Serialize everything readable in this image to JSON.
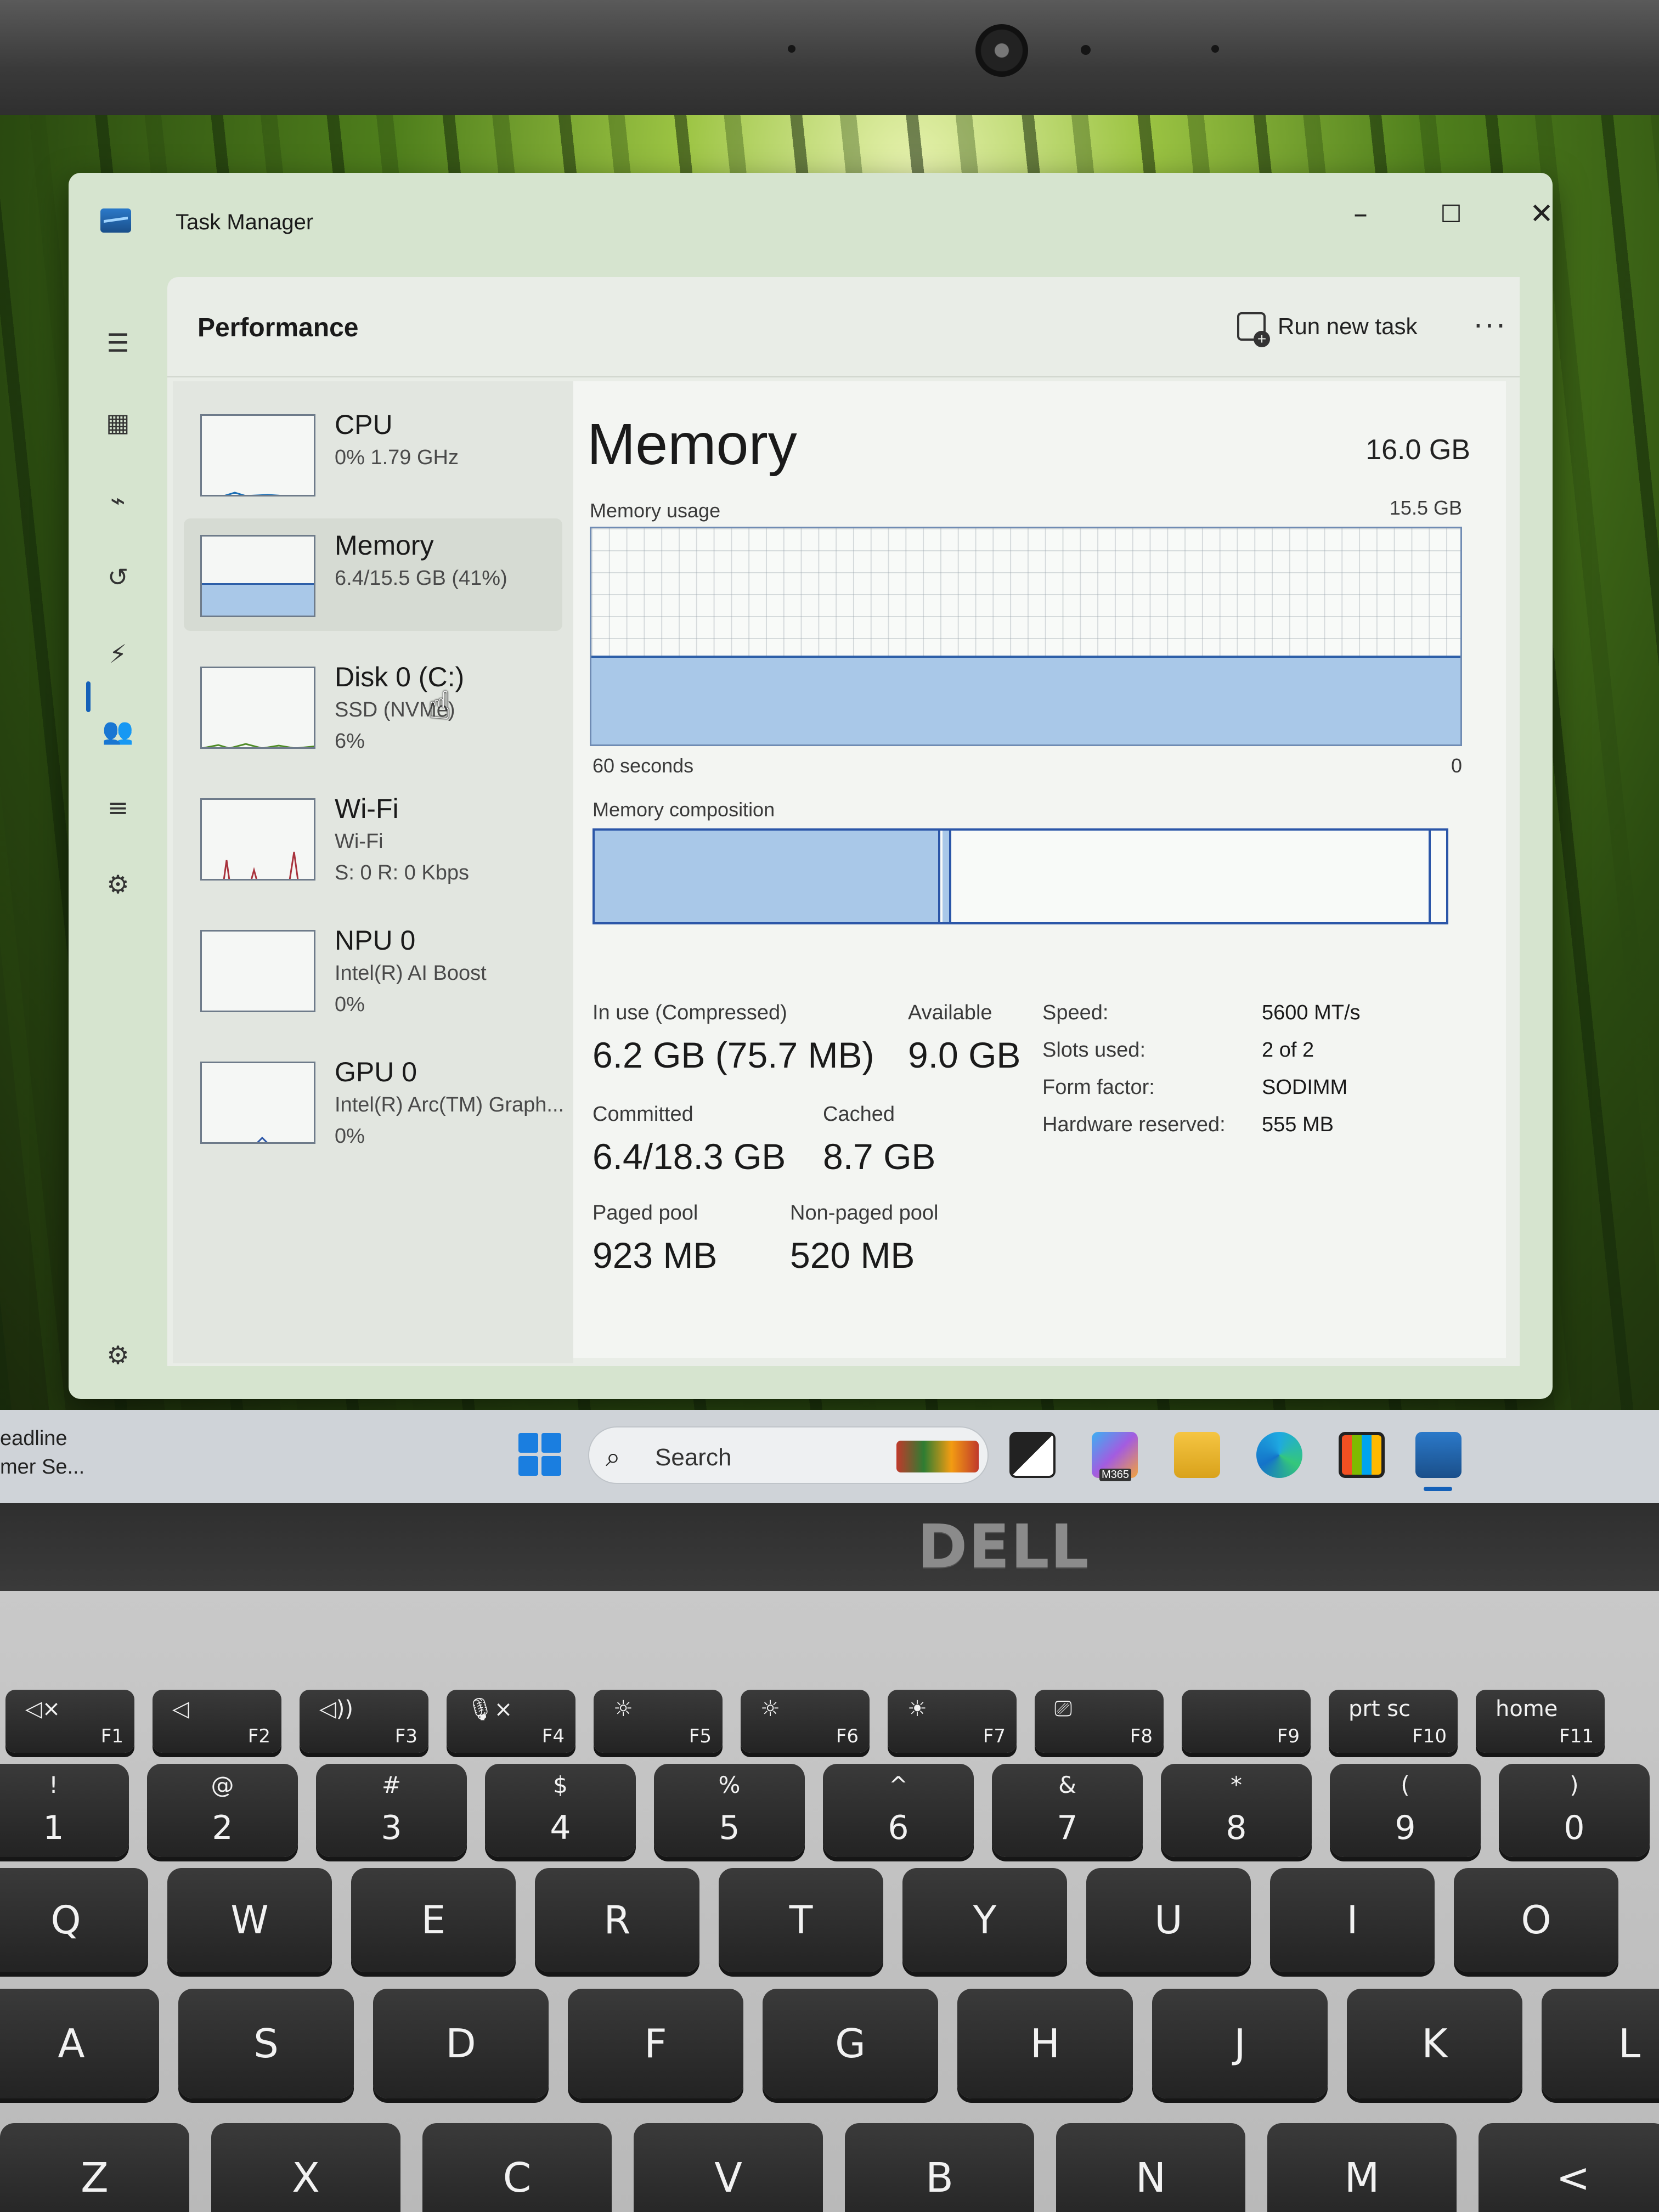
{
  "window": {
    "title": "Task Manager",
    "controls": {
      "minimize": "–",
      "maximize": "☐",
      "close": "✕"
    }
  },
  "header": {
    "title": "Performance",
    "run_new_task": "Run new task",
    "more": "···"
  },
  "rail_icons": [
    "menu-icon",
    "processes-icon",
    "performance-icon",
    "app-history-icon",
    "startup-icon",
    "users-icon",
    "details-icon",
    "services-icon",
    "settings-icon"
  ],
  "devices": [
    {
      "name": "CPU",
      "line1": "0%  1.79 GHz",
      "line2": ""
    },
    {
      "name": "Memory",
      "line1": "6.4/15.5 GB (41%)",
      "line2": ""
    },
    {
      "name": "Disk 0 (C:)",
      "line1": "SSD (NVMe)",
      "line2": "6%"
    },
    {
      "name": "Wi-Fi",
      "line1": "Wi-Fi",
      "line2": "S: 0  R: 0 Kbps"
    },
    {
      "name": "NPU 0",
      "line1": "Intel(R) AI Boost",
      "line2": "0%"
    },
    {
      "name": "GPU 0",
      "line1": "Intel(R) Arc(TM) Graph...",
      "line2": "0%"
    }
  ],
  "memory": {
    "title": "Memory",
    "total": "16.0 GB",
    "usage_label": "Memory usage",
    "usage_max": "15.5 GB",
    "usage_fraction": 0.41,
    "time_left": "60 seconds",
    "time_right": "0",
    "composition_label": "Memory composition",
    "stats": {
      "in_use_label": "In use (Compressed)",
      "in_use_value": "6.2 GB (75.7 MB)",
      "available_label": "Available",
      "available_value": "9.0 GB",
      "committed_label": "Committed",
      "committed_value": "6.4/18.3 GB",
      "cached_label": "Cached",
      "cached_value": "8.7 GB",
      "paged_label": "Paged pool",
      "paged_value": "923 MB",
      "nonpaged_label": "Non-paged pool",
      "nonpaged_value": "520 MB"
    },
    "specs": [
      {
        "label": "Speed:",
        "value": "5600 MT/s"
      },
      {
        "label": "Slots used:",
        "value": "2 of 2"
      },
      {
        "label": "Form factor:",
        "value": "SODIMM"
      },
      {
        "label": "Hardware reserved:",
        "value": "555 MB"
      }
    ],
    "colors": {
      "fill": "#a9c8e8",
      "border": "#2b56a8"
    }
  },
  "taskbar": {
    "news_line1": "eadline",
    "news_line2": "mer Se...",
    "search_placeholder": "Search",
    "copilot_badge": "M365"
  },
  "laptop": {
    "brand": "DELL"
  },
  "keyboard": {
    "fn_row": [
      {
        "icon": "◁×",
        "label": "F1"
      },
      {
        "icon": "◁",
        "label": "F2"
      },
      {
        "icon": "◁))",
        "label": "F3"
      },
      {
        "icon": "🎙×",
        "label": "F4"
      },
      {
        "icon": "☼",
        "label": "F5"
      },
      {
        "icon": "☼",
        "label": "F6"
      },
      {
        "icon": "☀",
        "label": "F7"
      },
      {
        "icon": "⎚",
        "label": "F8"
      },
      {
        "icon": "",
        "label": "F9"
      },
      {
        "icon": "prt sc",
        "label": "F10"
      },
      {
        "icon": "home",
        "label": "F11"
      }
    ],
    "num_row": [
      {
        "top": "!",
        "main": "1"
      },
      {
        "top": "@",
        "main": "2"
      },
      {
        "top": "#",
        "main": "3"
      },
      {
        "top": "$",
        "main": "4"
      },
      {
        "top": "%",
        "main": "5"
      },
      {
        "top": "^",
        "main": "6"
      },
      {
        "top": "&",
        "main": "7"
      },
      {
        "top": "*",
        "main": "8"
      },
      {
        "top": "(",
        "main": "9"
      },
      {
        "top": ")",
        "main": "0"
      }
    ],
    "row_q": [
      "Q",
      "W",
      "E",
      "R",
      "T",
      "Y",
      "U",
      "I",
      "O"
    ],
    "row_a": [
      "A",
      "S",
      "D",
      "F",
      "G",
      "H",
      "J",
      "K",
      "L"
    ],
    "row_z": [
      "Z",
      "X",
      "C",
      "V",
      "B",
      "N",
      "M",
      "<"
    ]
  }
}
